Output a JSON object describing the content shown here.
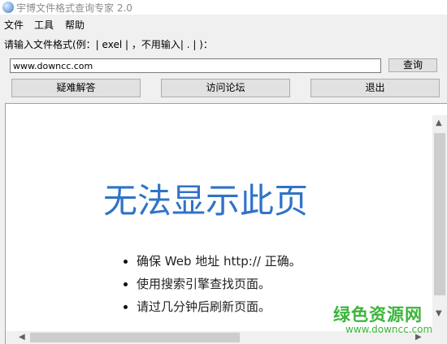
{
  "window": {
    "title": "宇博文件格式查询专家 2.0"
  },
  "menu": [
    "文件",
    "工具",
    "帮助"
  ],
  "prompt": "请输入文件格式(例：| exel | ，不用输入| . | )：",
  "search": {
    "value": "www.downcc.com",
    "button": "查询"
  },
  "buttons": {
    "faq": "疑难解答",
    "forum": "访问论坛",
    "exit": "退出"
  },
  "browser": {
    "error_title": "无法显示此页",
    "tips": [
      "确保 Web 地址 http:// 正确。",
      "使用搜索引擎查找页面。",
      "请过几分钟后刷新页面。"
    ]
  },
  "watermark": {
    "text": "绿色资源网",
    "url": "www.downcc.com"
  },
  "colors": {
    "error_title": "#2f73c8",
    "watermark": "#3bb53b"
  }
}
